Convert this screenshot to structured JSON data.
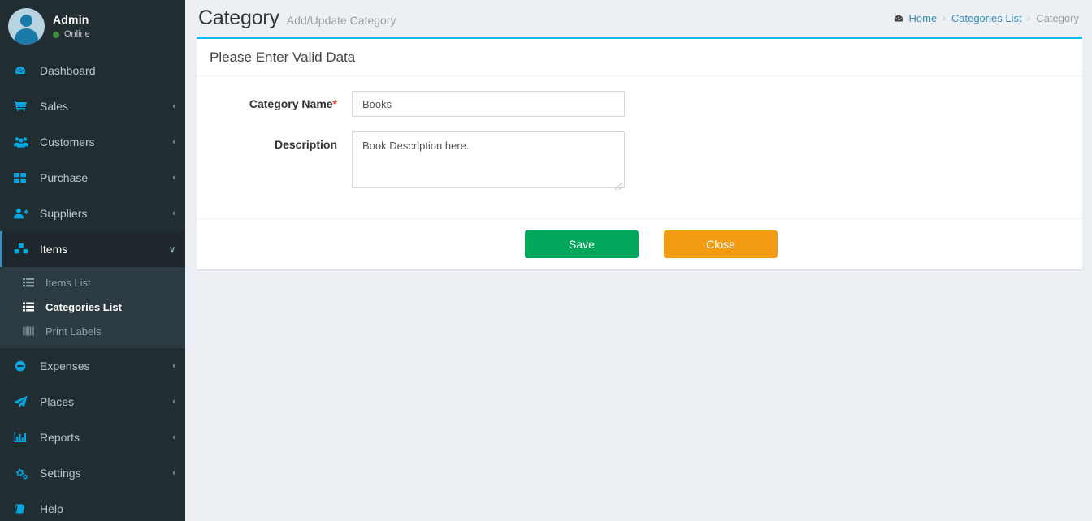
{
  "sidebar": {
    "user": {
      "name": "Admin",
      "status": "Online",
      "avatar_icon": "user-avatar-icon",
      "status_color": "#3c8f3c"
    },
    "items": [
      {
        "label": "Dashboard",
        "icon": "dashboard-icon",
        "arrow": "",
        "active": false
      },
      {
        "label": "Sales",
        "icon": "cart-icon",
        "arrow": "‹",
        "active": false
      },
      {
        "label": "Customers",
        "icon": "users-icon",
        "arrow": "‹",
        "active": false
      },
      {
        "label": "Purchase",
        "icon": "grid-icon",
        "arrow": "‹",
        "active": false
      },
      {
        "label": "Suppliers",
        "icon": "user-plus-icon",
        "arrow": "‹",
        "active": false
      },
      {
        "label": "Items",
        "icon": "cubes-icon",
        "arrow": "∨",
        "active": true
      },
      {
        "label": "Expenses",
        "icon": "minus-circle-icon",
        "arrow": "‹",
        "active": false
      },
      {
        "label": "Places",
        "icon": "paper-plane-icon",
        "arrow": "‹",
        "active": false
      },
      {
        "label": "Reports",
        "icon": "bar-chart-icon",
        "arrow": "‹",
        "active": false
      },
      {
        "label": "Settings",
        "icon": "gears-icon",
        "arrow": "‹",
        "active": false
      },
      {
        "label": "Help",
        "icon": "book-icon",
        "arrow": "",
        "active": false
      }
    ],
    "submenu": [
      {
        "label": "Items List",
        "icon": "list-icon",
        "selected": false
      },
      {
        "label": "Categories List",
        "icon": "list-icon",
        "selected": true
      },
      {
        "label": "Print Labels",
        "icon": "barcode-icon",
        "selected": false
      }
    ]
  },
  "header": {
    "title": "Category",
    "subtitle": "Add/Update Category",
    "breadcrumb": {
      "home_icon": "dashboard-icon",
      "home": "Home",
      "sep": "›",
      "middle": "Categories List",
      "current": "Category"
    }
  },
  "card": {
    "title": "Please Enter Valid Data",
    "accent_color": "#00c0ef",
    "fields": {
      "category_name": {
        "label": "Category Name",
        "required_mark": "*",
        "value": "Books",
        "placeholder": "Category Name"
      },
      "description": {
        "label": "Description",
        "value": "Book Description here.",
        "placeholder": "Description"
      }
    },
    "buttons": {
      "save": {
        "label": "Save",
        "color": "#00a65a"
      },
      "close": {
        "label": "Close",
        "color": "#f39c12"
      }
    }
  }
}
